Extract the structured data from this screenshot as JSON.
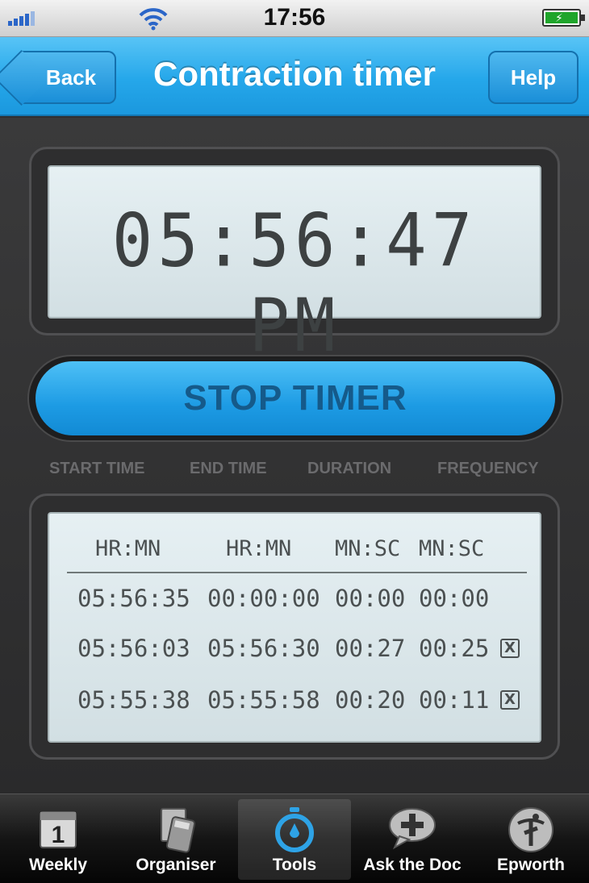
{
  "status_bar": {
    "time": "17:56"
  },
  "nav": {
    "back_label": "Back",
    "title": "Contraction timer",
    "help_label": "Help"
  },
  "clock": {
    "time": "05:56:47 PM"
  },
  "stop_button": {
    "label": "STOP TIMER"
  },
  "columns": [
    "START TIME",
    "END TIME",
    "DURATION",
    "FREQUENCY"
  ],
  "log": {
    "units": [
      "HR:MN",
      "HR:MN",
      "MN:SC",
      "MN:SC"
    ],
    "rows": [
      {
        "start": "05:56:35",
        "end": "00:00:00",
        "duration": "00:00",
        "frequency": "00:00",
        "delete": ""
      },
      {
        "start": "05:56:03",
        "end": "05:56:30",
        "duration": "00:27",
        "frequency": "00:25",
        "delete": "X"
      },
      {
        "start": "05:55:38",
        "end": "05:55:58",
        "duration": "00:20",
        "frequency": "00:11",
        "delete": "X"
      }
    ]
  },
  "tabs": [
    {
      "label": "Weekly",
      "icon": "calendar-icon"
    },
    {
      "label": "Organiser",
      "icon": "organiser-icon"
    },
    {
      "label": "Tools",
      "icon": "stopwatch-icon",
      "active": true
    },
    {
      "label": "Ask the Doc",
      "icon": "speech-bubble-plus-icon"
    },
    {
      "label": "Epworth",
      "icon": "epworth-logo-icon"
    }
  ],
  "colors": {
    "accent": "#25a7ea",
    "lcd": "#dce7ea",
    "background": "#2f2f30"
  }
}
